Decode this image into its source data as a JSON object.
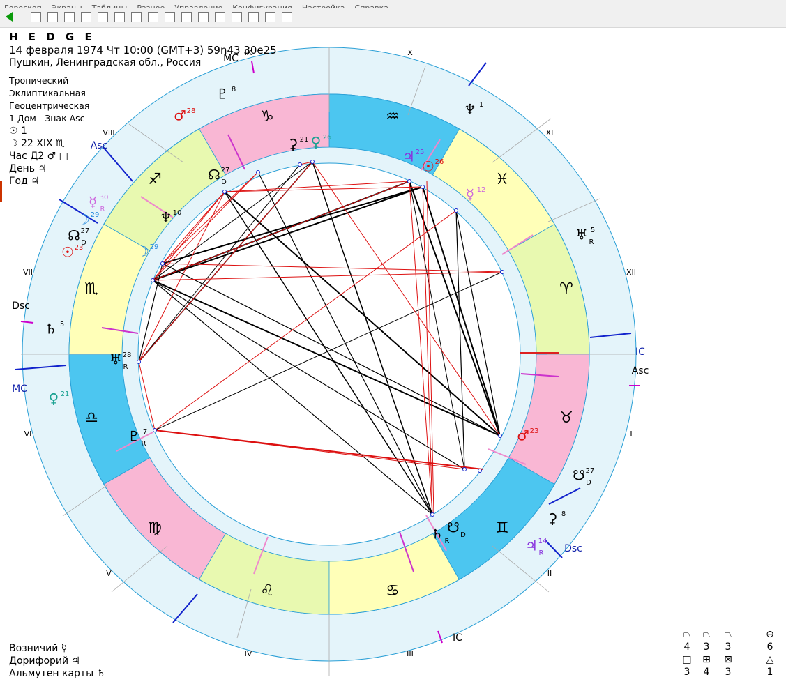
{
  "menu": [
    "Гороскоп",
    "Экраны",
    "Таблицы",
    "Разное",
    "Управление",
    "Конфигурация",
    "Настройка",
    "Справка"
  ],
  "toolbar_icons": [
    "back-arrow-icon",
    "grid-icon",
    "globe-icon",
    "table-icon",
    "star-map-icon",
    "image-icon",
    "g-icon",
    "scroll-icon",
    "check-icon",
    "list-icon",
    "doc-icon",
    "card-icon",
    "flag-icon",
    "ring-icon",
    "tool-icon",
    "person-icon",
    "sitting-icon"
  ],
  "header": {
    "name": "H E D G E",
    "date_line": "14 февраля 1974  Чт  10:00 (GMT+3) 59n43  30e25",
    "place": "Пушкин, Ленинградская обл., Россия",
    "settings": [
      "Тропический",
      "Эклиптикальная",
      "Геоцентрическая",
      "1 Дом - Знак Asc"
    ],
    "sun_phase": "☉ 1",
    "moon_day": "☽ 22 XIX ♏",
    "hour": "Час Д2 ♂ □",
    "day": "День ♃",
    "year": "Год ♃"
  },
  "footer": {
    "vozn": "Возничий ☿",
    "dorif": "Дорифорий ♃",
    "almuten": "Альмутен карты ♄"
  },
  "wheel": {
    "outer_houses": [
      "I",
      "II",
      "III",
      "IV",
      "V",
      "VI",
      "VII",
      "VIII",
      "IX",
      "X",
      "XI",
      "XII"
    ],
    "axis_labels": {
      "asc": "Asc",
      "dsc": "Dsc",
      "mc": "MC",
      "ic": "IC"
    },
    "signs": [
      "♈",
      "♉",
      "♊",
      "♋",
      "♌",
      "♍",
      "♎",
      "♏",
      "♐",
      "♑",
      "♒",
      "♓"
    ],
    "natal_planets": [
      {
        "g": "♆",
        "deg": "1"
      },
      {
        "g": "⚳",
        "deg": "21"
      },
      {
        "g": "♀",
        "deg": "26"
      },
      {
        "g": "♃",
        "deg": "25"
      },
      {
        "g": "☉",
        "deg": "26"
      },
      {
        "g": "☿",
        "deg": "12"
      },
      {
        "g": "♅",
        "deg": "5",
        "r": "R"
      },
      {
        "g": "♂",
        "deg": "23"
      },
      {
        "g": "☋",
        "deg": "27",
        "r": "D"
      },
      {
        "g": "♄",
        "deg": "",
        "r": "R"
      },
      {
        "g": "☋",
        "deg": "",
        "r": "D"
      },
      {
        "g": "♅",
        "deg": "28",
        "r": "R"
      },
      {
        "g": "♇",
        "deg": "7",
        "r": "R"
      },
      {
        "g": "☽",
        "deg": "29"
      },
      {
        "g": "♆",
        "deg": "10"
      },
      {
        "g": "☊",
        "deg": "27",
        "r": "D"
      },
      {
        "g": "♂",
        "deg": "28"
      },
      {
        "g": "♇",
        "deg": "8"
      }
    ],
    "outer_planets": [
      {
        "g": "☿",
        "deg": "30",
        "r": "R"
      },
      {
        "g": "☽",
        "deg": "29"
      },
      {
        "g": "☊",
        "deg": "27",
        "r": "D"
      },
      {
        "g": "☉",
        "deg": "23"
      },
      {
        "g": "♄",
        "deg": "5"
      },
      {
        "g": "♀",
        "deg": "21"
      },
      {
        "g": "⚳",
        "deg": "8"
      },
      {
        "g": "♃",
        "deg": "14",
        "r": "R"
      }
    ]
  },
  "aspect_table": {
    "row1_syms": [
      "⏢",
      "⏢",
      "⏢",
      "⊖"
    ],
    "row1_vals": [
      "4",
      "3",
      "3",
      "6"
    ],
    "row2_syms": [
      "□",
      "⊞",
      "⊠",
      "△"
    ],
    "row2_vals": [
      "3",
      "4",
      "3",
      "1"
    ]
  },
  "colors": {
    "blue": "#4cc6f0",
    "pink": "#f9b7d4",
    "green": "#e8f9b0",
    "yellow": "#ffffb8",
    "light": "#e4f4fa",
    "red": "#dd1111",
    "purple": "#9933cc"
  }
}
